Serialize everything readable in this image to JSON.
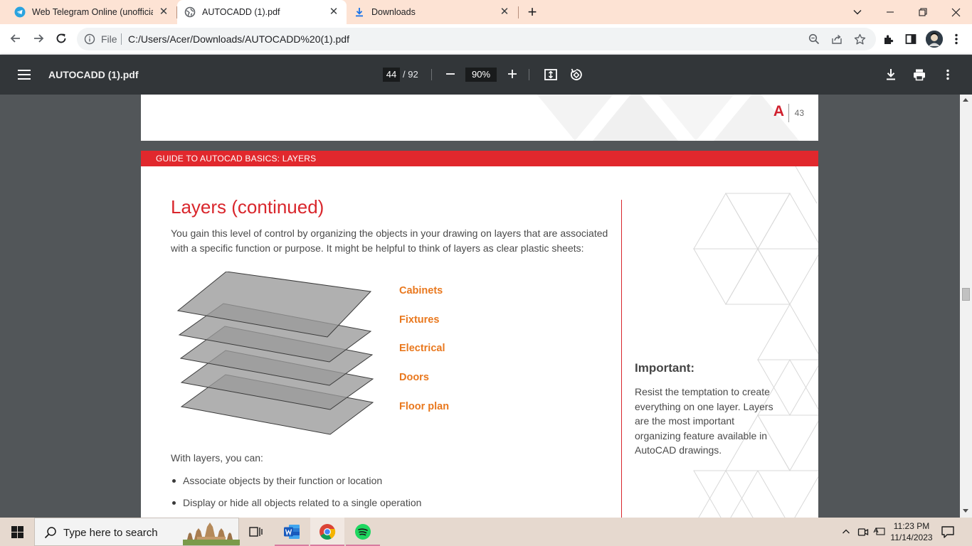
{
  "browser": {
    "tabs": [
      {
        "title": "Web Telegram Online (unofficial)",
        "icon": "telegram-icon"
      },
      {
        "title": "AUTOCADD (1).pdf",
        "icon": "globe-icon"
      },
      {
        "title": "Downloads",
        "icon": "download-icon"
      }
    ],
    "address": {
      "scheme_label": "File",
      "url": "C:/Users/Acer/Downloads/AUTOCADD%20(1).pdf"
    }
  },
  "pdf_toolbar": {
    "title": "AUTOCADD (1).pdf",
    "current_page": "44",
    "total_pages": "/ 92",
    "zoom": "90%"
  },
  "prev_page": {
    "page_number": "43",
    "logo_letter": "A"
  },
  "page": {
    "header_bar": "GUIDE TO AUTOCAD BASICS: LAYERS",
    "heading": "Layers (continued)",
    "intro": "You gain this level of control by organizing the objects in your drawing on layers that are associated with a specific function or purpose. It might be helpful to think of layers as clear plastic sheets:",
    "layer_labels": [
      "Cabinets",
      "Fixtures",
      "Electrical",
      "Doors",
      "Floor plan"
    ],
    "with_layers": "With layers, you can:",
    "bullets": [
      "Associate objects by their function or location",
      "Display or hide all objects related to a single operation"
    ],
    "important_title": "Important:",
    "important_body": "Resist the temptation to create everything on one layer. Layers are the most important organizing feature available in AutoCAD drawings."
  },
  "taskbar": {
    "search_placeholder": "Type here to search",
    "time": "11:23 PM",
    "date": "11/14/2023"
  },
  "colors": {
    "accent_red": "#e1282d",
    "label_orange": "#e9781e",
    "tabstrip": "#fde3d4"
  }
}
